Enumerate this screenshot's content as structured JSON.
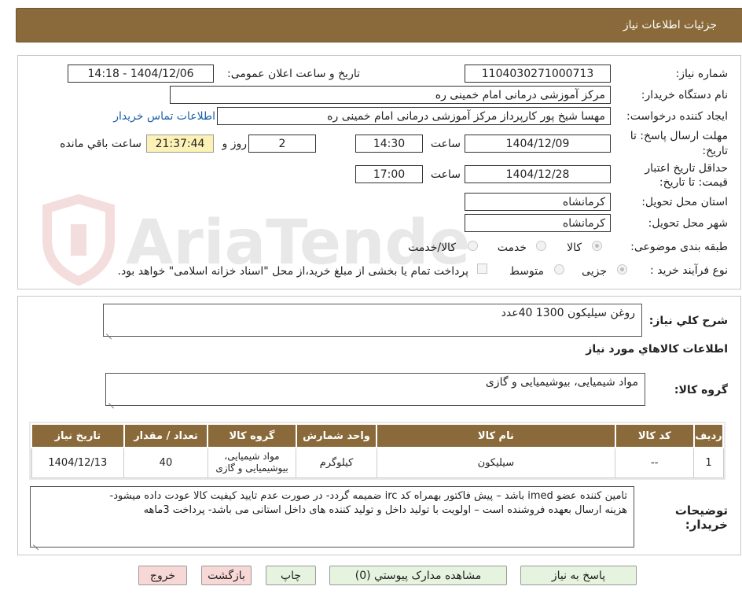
{
  "header": {
    "title": "جزئیات اطلاعات نیاز"
  },
  "form": {
    "need_number_label": "شماره نیاز:",
    "need_number": "1104030271000713",
    "announce_label": "تاریخ و ساعت اعلان عمومی:",
    "announce_value": "1404/12/06 - 14:18",
    "buyer_label": "نام دستگاه خریدار:",
    "buyer_value": "مرکز آموزشی درمانی امام خمینی ره",
    "creator_label": "ایجاد کننده درخواست:",
    "creator_value": "مهسا شیخ پور کارپرداز مرکز آموزشی درمانی امام خمینی ره",
    "contact_link": "اطلاعات تماس خریدار",
    "deadline_label_1": "مهلت ارسال پاسخ: تا",
    "deadline_label_2": "تاریخ:",
    "deadline_date": "1404/12/09",
    "time_label": "ساعت",
    "deadline_time": "14:30",
    "days_value": "2",
    "days_label": "روز و",
    "remaining_time": "21:37:44",
    "remaining_label": "ساعت باقي مانده",
    "validity_label_1": "حداقل تاریخ اعتبار",
    "validity_label_2": "قیمت: تا تاریخ:",
    "validity_date": "1404/12/28",
    "validity_time": "17:00",
    "province_label": "استان محل تحویل:",
    "province_value": "کرمانشاه",
    "city_label": "شهر محل تحویل:",
    "city_value": "کرمانشاه",
    "category_label": "طبقه بندی موضوعی:",
    "category_options": [
      "کالا",
      "خدمت",
      "کالا/خدمت"
    ],
    "process_label": "نوع فرآیند خرید :",
    "process_options": [
      "جزیی",
      "متوسط"
    ],
    "payment_note": "پرداخت تمام یا بخشی از مبلغ خرید،از محل \"اسناد خزانه اسلامی\" خواهد بود."
  },
  "summary": {
    "label": "شرح کلي نياز:",
    "value": "روغن سیلیکون 1300 40عدد",
    "goods_info_title": "اطلاعات کالاهاي مورد نياز",
    "group_label": "گروه کالا:",
    "group_value": "مواد شیمیایی، بیوشیمیایی و  گازی"
  },
  "table": {
    "headers": [
      "ردیف",
      "کد کالا",
      "نام کالا",
      "واحد شمارش",
      "گروه کالا",
      "تعداد / مقدار",
      "تاریخ نیاز"
    ],
    "rows": [
      {
        "row": "1",
        "code": "--",
        "name": "سیلیکون",
        "unit": "کیلوگرم",
        "group_line1": "مواد شیمیایی،",
        "group_line2": "بیوشیمیایی و گازی",
        "qty": "40",
        "date": "1404/12/13"
      }
    ]
  },
  "notes": {
    "label_1": "توضیحات",
    "label_2": "خریدار:",
    "line1": "تامین کننده عضو imed باشد – پیش فاکتور بهمراه کد irc ضمیمه گردد- در صورت عدم تایید کیفیت کالا عودت داده میشود-",
    "line2": "هزینه ارسال بعهده فروشنده است – اولویت با تولید داخل و تولید کننده های داخل استانی می باشد- پرداخت 3ماهه"
  },
  "buttons": {
    "reply": "پاسخ به نیاز",
    "attachments": "مشاهده مدارک پیوستي (0)",
    "print": "چاپ",
    "back": "بازگشت",
    "exit": "خروج"
  },
  "watermark": {
    "text": "AriaTender.neT"
  },
  "colors": {
    "header_bg": "#8a6a3a",
    "button_green": "#e6f3df",
    "button_pink": "#f8d7d7",
    "highlight": "#fdf2b6",
    "link": "#1a5fa8"
  }
}
